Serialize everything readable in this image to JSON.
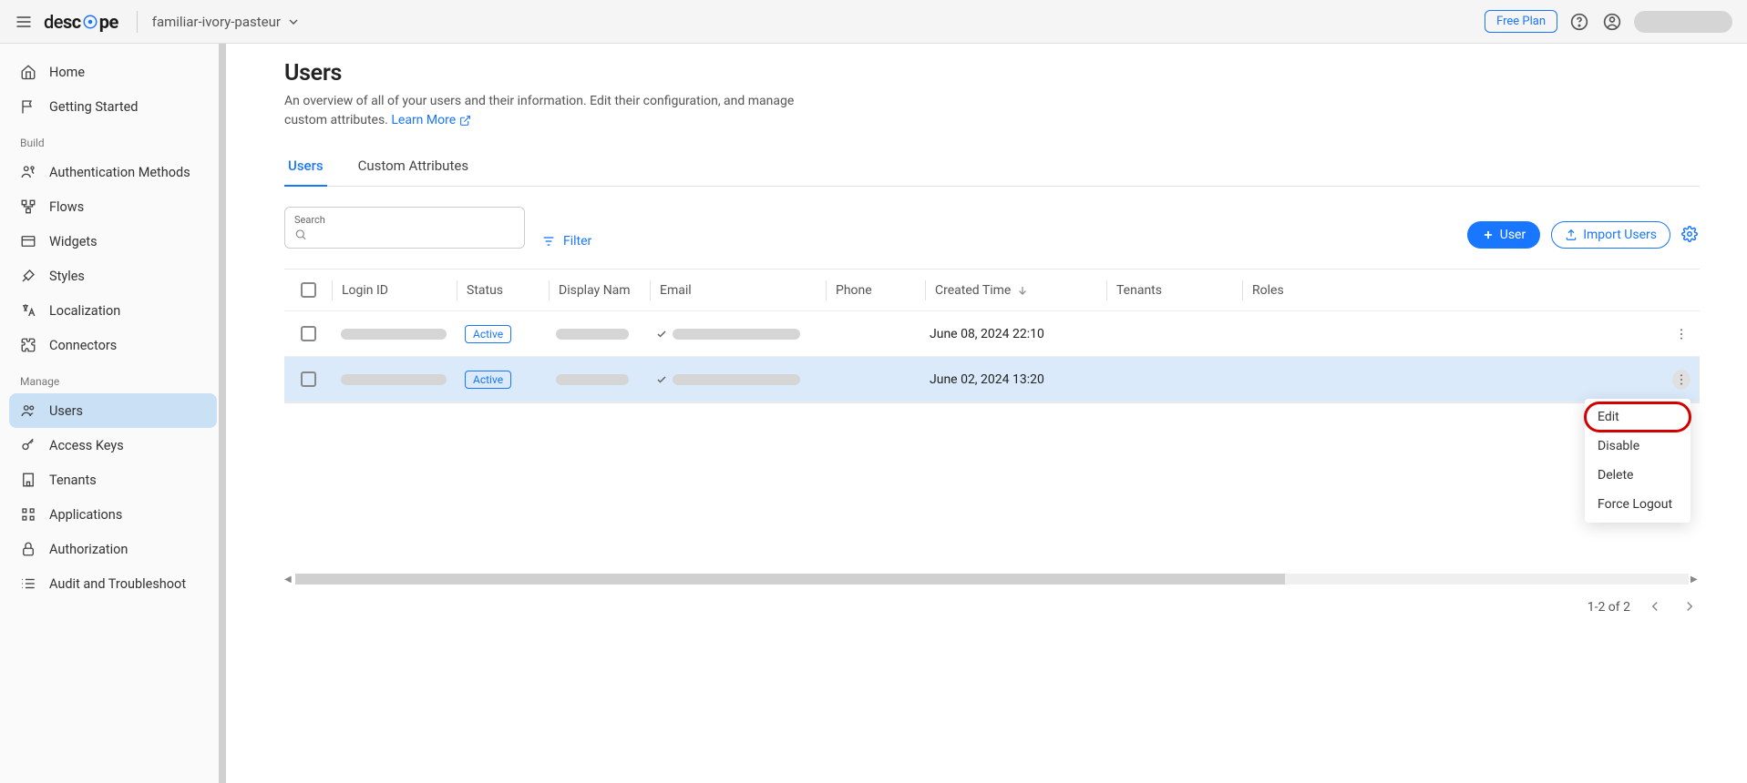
{
  "header": {
    "project_name": "familiar-ivory-pasteur",
    "free_plan_label": "Free Plan"
  },
  "sidebar": {
    "top": [
      {
        "key": "home",
        "label": "Home",
        "icon": "home-icon"
      },
      {
        "key": "getting-started",
        "label": "Getting Started",
        "icon": "flag-icon"
      }
    ],
    "sections": [
      {
        "title": "Build",
        "items": [
          {
            "key": "auth-methods",
            "label": "Authentication Methods",
            "icon": "key-user-icon"
          },
          {
            "key": "flows",
            "label": "Flows",
            "icon": "flows-icon"
          },
          {
            "key": "widgets",
            "label": "Widgets",
            "icon": "widgets-icon"
          },
          {
            "key": "styles",
            "label": "Styles",
            "icon": "brush-icon"
          },
          {
            "key": "localization",
            "label": "Localization",
            "icon": "translate-icon"
          },
          {
            "key": "connectors",
            "label": "Connectors",
            "icon": "puzzle-icon"
          }
        ]
      },
      {
        "title": "Manage",
        "items": [
          {
            "key": "users",
            "label": "Users",
            "icon": "users-icon",
            "active": true
          },
          {
            "key": "access-keys",
            "label": "Access Keys",
            "icon": "key-icon"
          },
          {
            "key": "tenants",
            "label": "Tenants",
            "icon": "building-icon"
          },
          {
            "key": "applications",
            "label": "Applications",
            "icon": "apps-icon"
          },
          {
            "key": "authorization",
            "label": "Authorization",
            "icon": "lock-icon"
          },
          {
            "key": "audit",
            "label": "Audit and Troubleshoot",
            "icon": "list-icon"
          }
        ]
      }
    ]
  },
  "page": {
    "title": "Users",
    "description_part1": "An overview of all of your users and their information. Edit their configuration, and manage custom attributes.",
    "learn_more_label": "Learn More"
  },
  "tabs": [
    {
      "key": "users",
      "label": "Users",
      "active": true
    },
    {
      "key": "custom-attributes",
      "label": "Custom Attributes"
    }
  ],
  "toolbar": {
    "search_label": "Search",
    "filter_label": "Filter",
    "add_user_label": "User",
    "import_label": "Import Users"
  },
  "table": {
    "columns": {
      "login_id": "Login ID",
      "status": "Status",
      "display_name": "Display Nam",
      "email": "Email",
      "phone": "Phone",
      "created_time": "Created Time",
      "tenants": "Tenants",
      "roles": "Roles"
    },
    "rows": [
      {
        "status": "Active",
        "created_time": "June 08, 2024 22:10",
        "selected": false,
        "menu_open": false
      },
      {
        "status": "Active",
        "created_time": "June 02, 2024 13:20",
        "selected": true,
        "menu_open": true
      }
    ]
  },
  "context_menu": {
    "items": [
      {
        "key": "edit",
        "label": "Edit",
        "highlighted": true
      },
      {
        "key": "disable",
        "label": "Disable"
      },
      {
        "key": "delete",
        "label": "Delete"
      },
      {
        "key": "force-logout",
        "label": "Force Logout"
      }
    ]
  },
  "pagination": {
    "label": "1-2 of 2"
  }
}
